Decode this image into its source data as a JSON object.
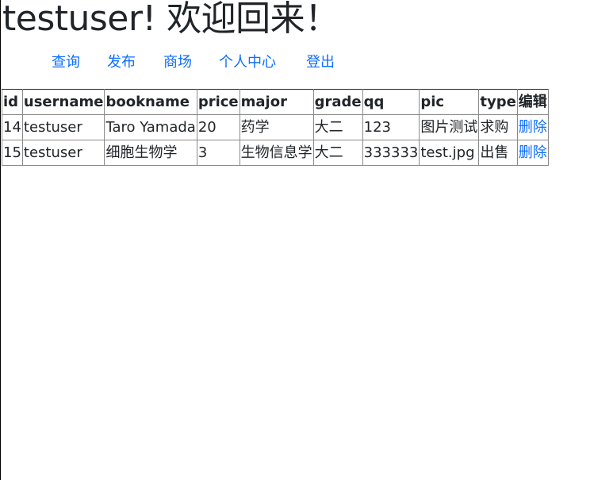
{
  "header": {
    "title": "testuser! 欢迎回来！"
  },
  "nav": {
    "items": [
      {
        "label": "查询"
      },
      {
        "label": "发布"
      },
      {
        "label": "商场"
      },
      {
        "label": "个人中心"
      },
      {
        "label": "登出"
      }
    ]
  },
  "table": {
    "columns": [
      "id",
      "username",
      "bookname",
      "price",
      "major",
      "grade",
      "qq",
      "pic",
      "type",
      "编辑"
    ],
    "rows": [
      {
        "id": "14",
        "username": "testuser",
        "bookname": "Taro Yamada",
        "price": "20",
        "major": "药学",
        "grade": "大二",
        "qq": "123",
        "pic": "图片测试",
        "type": "求购",
        "action": "删除"
      },
      {
        "id": "15",
        "username": "testuser",
        "bookname": "细胞生物学",
        "price": "3",
        "major": "生物信息学",
        "grade": "大二",
        "qq": "333333",
        "pic": "test.jpg",
        "type": "出售",
        "action": "删除"
      }
    ]
  },
  "colors": {
    "link": "#0d6efd",
    "text": "#212529",
    "border": "#8a8a8a"
  }
}
